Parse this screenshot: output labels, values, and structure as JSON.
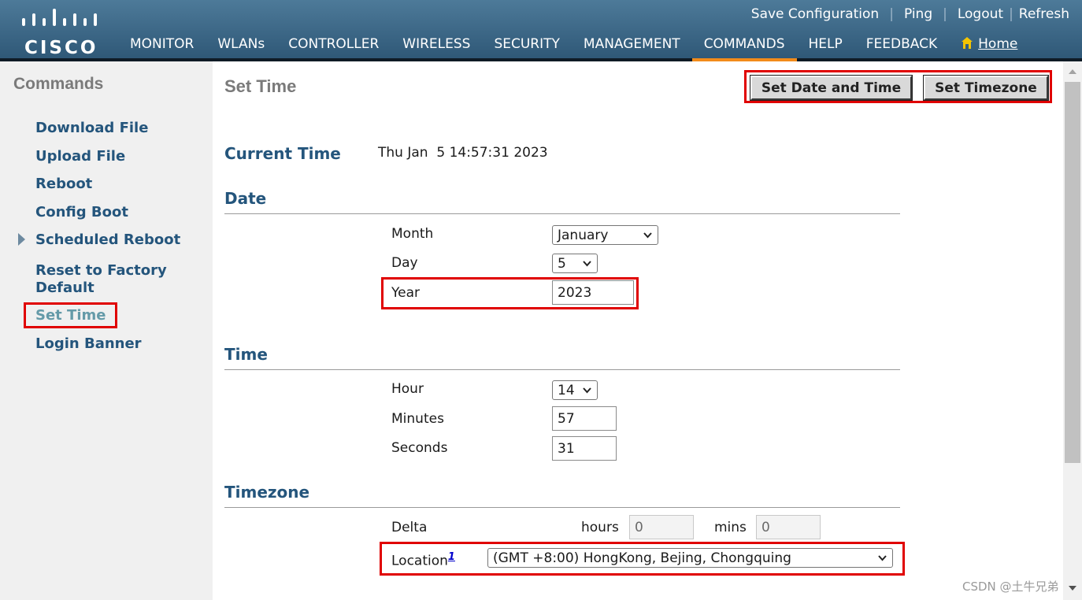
{
  "brand": {
    "logo_text": "CISCO"
  },
  "top_links": {
    "save": "Save Configuration",
    "ping": "Ping",
    "logout": "Logout",
    "refresh": "Refresh"
  },
  "nav": {
    "items": [
      "MONITOR",
      "WLANs",
      "CONTROLLER",
      "WIRELESS",
      "SECURITY",
      "MANAGEMENT",
      "COMMANDS",
      "HELP",
      "FEEDBACK"
    ],
    "active": "COMMANDS",
    "home": "Home"
  },
  "sidebar": {
    "title": "Commands",
    "items": [
      {
        "label": "Download File"
      },
      {
        "label": "Upload File"
      },
      {
        "label": "Reboot"
      },
      {
        "label": "Config Boot"
      },
      {
        "label": "Scheduled Reboot"
      },
      {
        "label": "Reset to Factory Default"
      },
      {
        "label": "Set Time"
      },
      {
        "label": "Login Banner"
      }
    ],
    "active": "Set Time"
  },
  "page": {
    "title": "Set Time",
    "buttons": {
      "set_date_time": "Set Date and Time",
      "set_timezone": "Set Timezone"
    },
    "current_time": {
      "label": "Current Time",
      "value": "Thu Jan  5 14:57:31 2023"
    }
  },
  "date": {
    "heading": "Date",
    "month": {
      "label": "Month",
      "value": "January"
    },
    "day": {
      "label": "Day",
      "value": "5"
    },
    "year": {
      "label": "Year",
      "value": "2023"
    }
  },
  "time": {
    "heading": "Time",
    "hour": {
      "label": "Hour",
      "value": "14"
    },
    "minutes": {
      "label": "Minutes",
      "value": "57"
    },
    "seconds": {
      "label": "Seconds",
      "value": "31"
    }
  },
  "timezone": {
    "heading": "Timezone",
    "delta": {
      "label": "Delta",
      "hours_label": "hours",
      "hours_value": "0",
      "mins_label": "mins",
      "mins_value": "0"
    },
    "location": {
      "label": "Location",
      "footnote": "1",
      "value": "(GMT +8:00) HongKong, Bejing, Chongquing"
    }
  },
  "watermark": "CSDN @土牛兄弟",
  "colors": {
    "header": "#3d6987",
    "accent_active_tab": "#f28b1a",
    "section_heading": "#24557c",
    "highlight": "#e00000"
  }
}
